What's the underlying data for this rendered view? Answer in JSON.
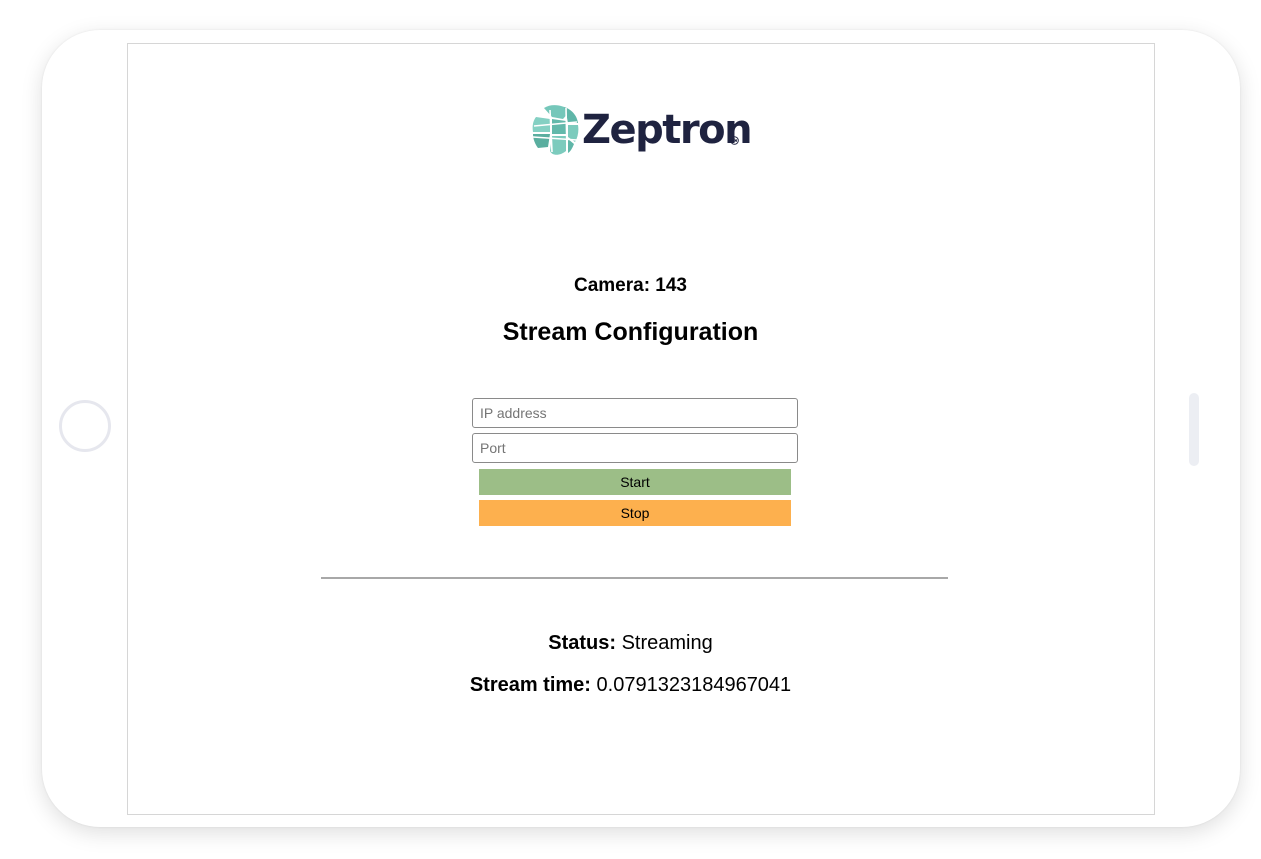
{
  "brand": {
    "name": "Zeptron",
    "mark_color": "#6ec4b6",
    "text_color": "#1f2340"
  },
  "header": {
    "camera_title": "Camera: 143",
    "page_title": "Stream Configuration"
  },
  "form": {
    "ip_placeholder": "IP address",
    "ip_value": "",
    "port_placeholder": "Port",
    "port_value": "",
    "start_label": "Start",
    "stop_label": "Stop",
    "start_color": "#9cbe87",
    "stop_color": "#fdb04e"
  },
  "status": {
    "status_label": "Status:",
    "status_value": "Streaming",
    "time_label": "Stream time:",
    "time_value": "0.0791323184967041"
  }
}
